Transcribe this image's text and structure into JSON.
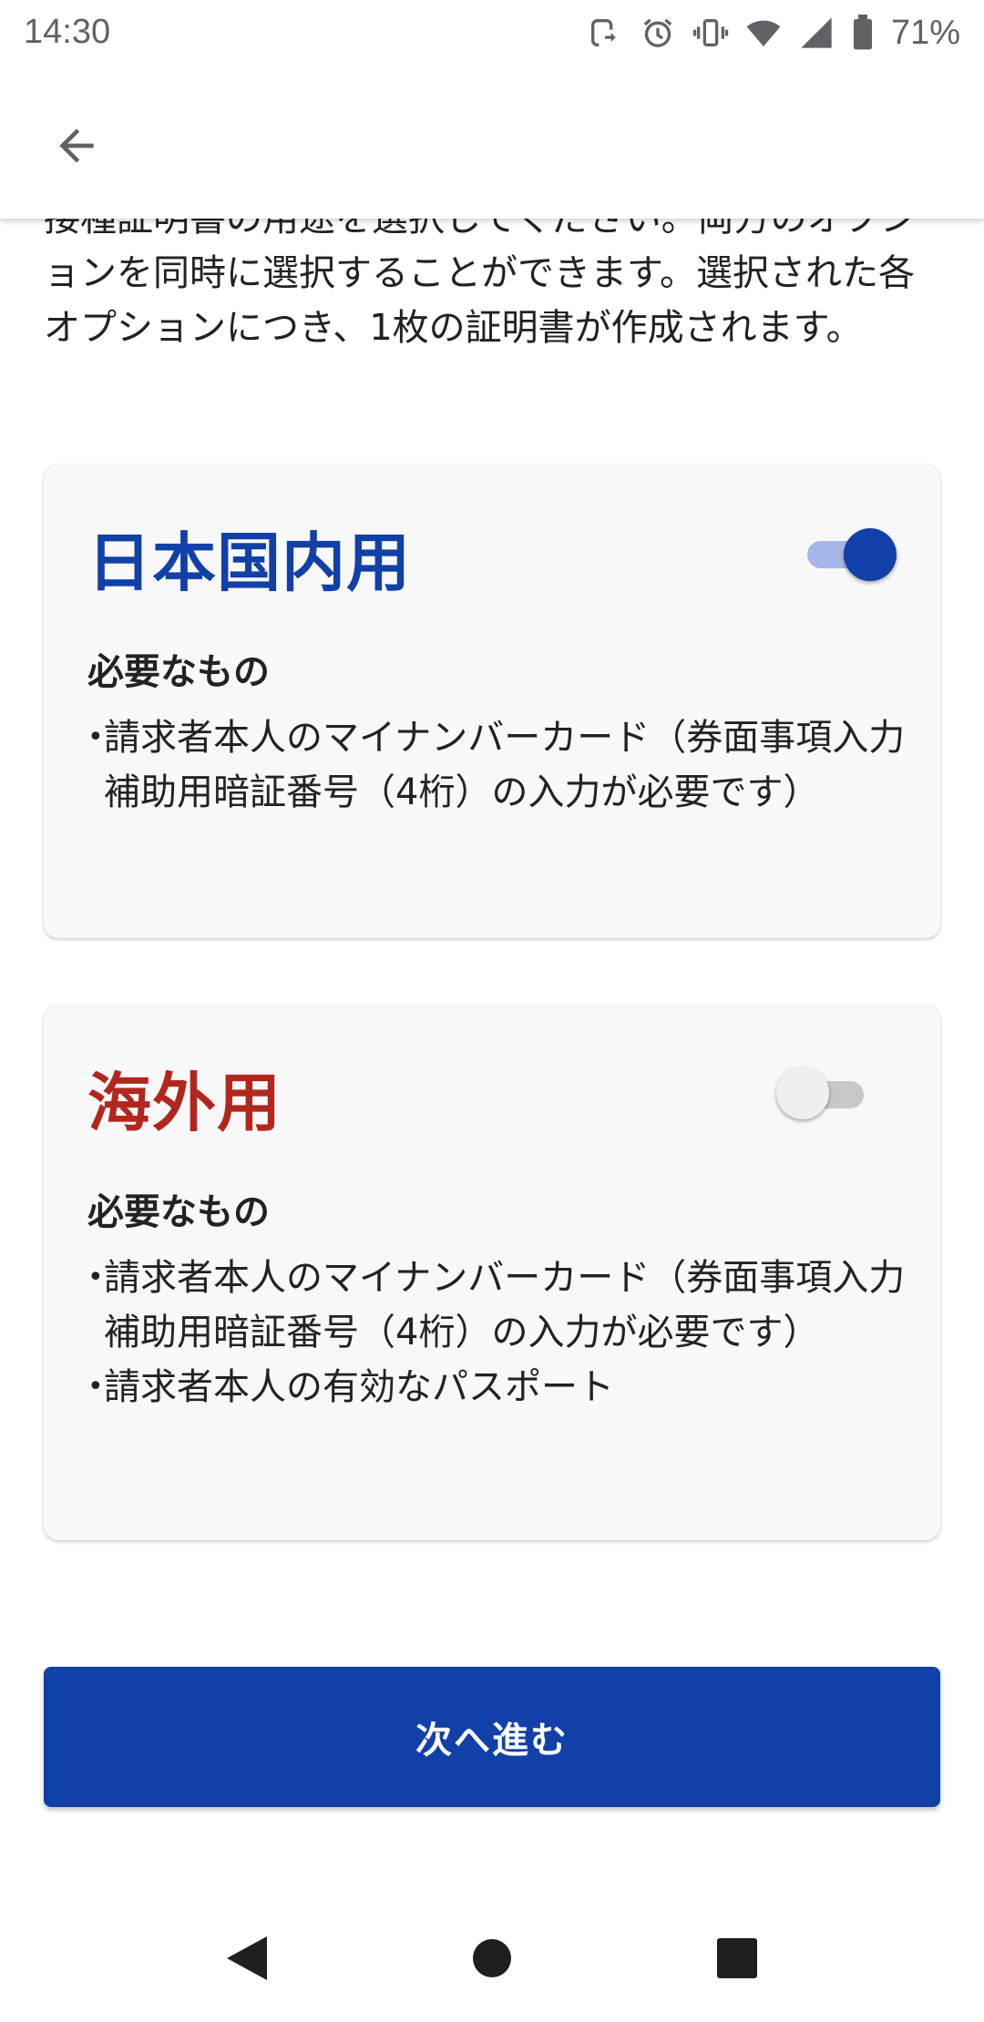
{
  "status_bar": {
    "time": "14:30",
    "battery_percent": "71%",
    "icons": [
      "nfc-icon",
      "alarm-icon",
      "vibrate-icon",
      "wifi-icon",
      "signal-icon",
      "battery-icon"
    ]
  },
  "app_bar": {
    "back_icon": "arrow-left-icon"
  },
  "intro_text": "接種証明書の用途を選択してください。両方のオプションを同時に選択することができます。選択された各オプションにつき、1枚の証明書が作成されます。",
  "cards": [
    {
      "title": "日本国内用",
      "toggle_on": true,
      "requirements_heading": "必要なもの",
      "requirements": [
        "請求者本人のマイナンバーカード（券面事項入力補助用暗証番号（4桁）の入力が必要です）"
      ]
    },
    {
      "title": "海外用",
      "toggle_on": false,
      "requirements_heading": "必要なもの",
      "requirements": [
        "請求者本人のマイナンバーカード（券面事項入力補助用暗証番号（4桁）の入力が必要です）",
        "請求者本人の有効なパスポート"
      ]
    }
  ],
  "next_button_label": "次へ進む",
  "nav_bar": {
    "icons": [
      "nav-back-icon",
      "nav-home-icon",
      "nav-recents-icon"
    ]
  },
  "colors": {
    "primary": "#1140a8",
    "domestic_title": "#1140a8",
    "overseas_title": "#b3261e",
    "card_background": "#f8f8f8"
  }
}
